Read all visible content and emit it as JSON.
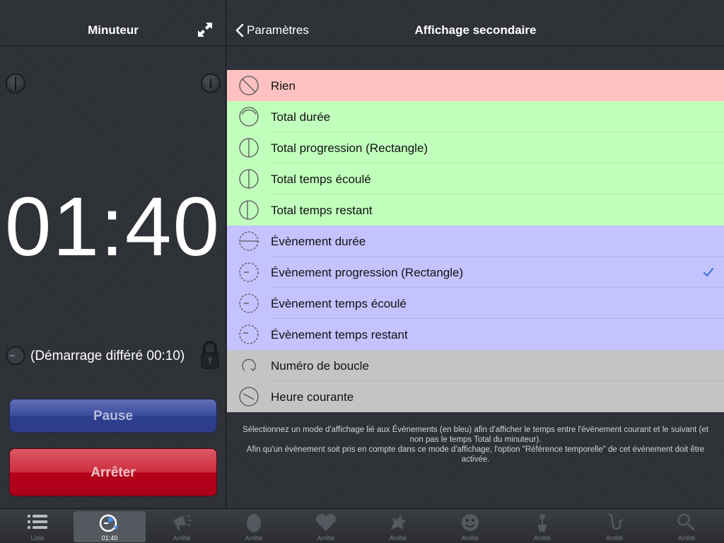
{
  "left": {
    "title": "Minuteur",
    "info_glyph": "i",
    "timer": "01:40",
    "delay_text": "(Démarrage différé 00:10)",
    "pause_label": "Pause",
    "stop_label": "Arrêter"
  },
  "right": {
    "back_label": "Paramètres",
    "title": "Affichage secondaire",
    "options": [
      {
        "label": "Rien",
        "group": "red",
        "icon": "none-icon"
      },
      {
        "label": "Total durée",
        "group": "green",
        "icon": "total-duration-icon"
      },
      {
        "label": "Total progression (Rectangle)",
        "group": "green",
        "icon": "total-progress-icon"
      },
      {
        "label": "Total temps écoulé",
        "group": "green",
        "icon": "total-elapsed-icon"
      },
      {
        "label": "Total temps restant",
        "group": "green",
        "icon": "total-remaining-icon"
      },
      {
        "label": "Évènement durée",
        "group": "blue",
        "icon": "event-duration-icon"
      },
      {
        "label": "Évènement progression (Rectangle)",
        "group": "blue",
        "icon": "event-progress-icon",
        "selected": true
      },
      {
        "label": "Évènement temps écoulé",
        "group": "blue",
        "icon": "event-elapsed-icon"
      },
      {
        "label": "Évènement temps restant",
        "group": "blue",
        "icon": "event-remaining-icon"
      },
      {
        "label": "Numéro de boucle",
        "group": "grey",
        "icon": "loop-number-icon"
      },
      {
        "label": "Heure courante",
        "group": "grey",
        "icon": "current-time-icon"
      }
    ],
    "footer_note_1": "Sélectionnez un mode d'affichage lié aux Évènements (en bleu) afin d'afficher le temps entre l'évènement courant et le suivant (et non pas le temps Total du minuteur).",
    "footer_note_2": "Afin qu'un évènement soit pris en compte dans ce mode d'affichage, l'option \"Référence temporelle\" de cet évènement doit être activée."
  },
  "tabs": [
    {
      "label": "Liste",
      "icon": "list-icon"
    },
    {
      "label": "01:40",
      "icon": "timer-icon",
      "active": true
    },
    {
      "label": "Arrêté",
      "icon": "megaphone-icon"
    },
    {
      "label": "Arrêté",
      "icon": "egg-icon"
    },
    {
      "label": "Arrêté",
      "icon": "heart-icon"
    },
    {
      "label": "Arrêté",
      "icon": "dragon-icon"
    },
    {
      "label": "Arrêté",
      "icon": "smiley-icon"
    },
    {
      "label": "Arrêté",
      "icon": "flower-pot-icon"
    },
    {
      "label": "Arrêté",
      "icon": "saxophone-icon"
    },
    {
      "label": "Arrêté",
      "icon": "tennis-racket-icon"
    }
  ],
  "colors": {
    "red": "#ffc1c1",
    "green": "#c1ffbd",
    "blue": "#c4c2ff",
    "grey": "#c4c4c4",
    "check": "#2f6fd8"
  }
}
